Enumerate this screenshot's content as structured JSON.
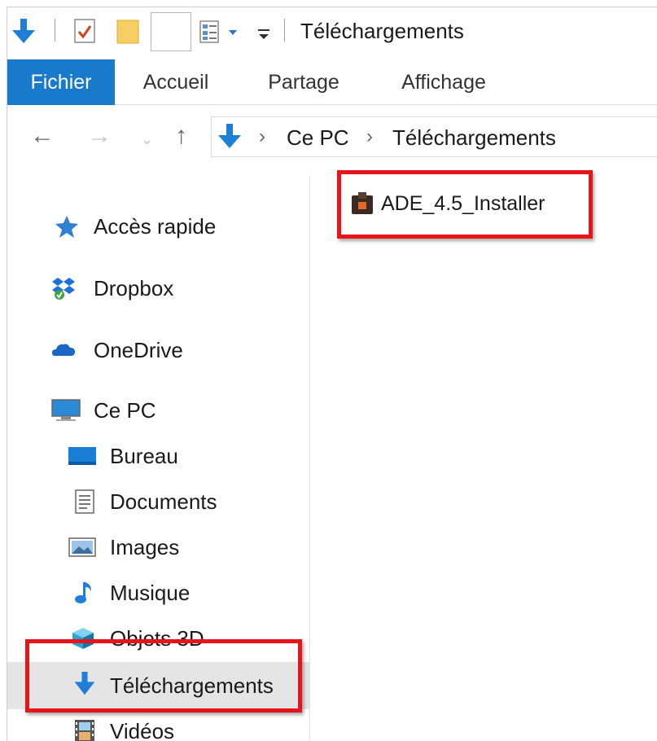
{
  "titlebar": {
    "title": "Téléchargements"
  },
  "ribbon": {
    "tabs": [
      "Fichier",
      "Accueil",
      "Partage",
      "Affichage"
    ]
  },
  "address": {
    "crumbs": [
      "Ce PC",
      "Téléchargements"
    ]
  },
  "nav": {
    "items": [
      {
        "label": "Accès rapide",
        "icon": "star-icon"
      },
      {
        "label": "Dropbox",
        "icon": "dropbox-icon"
      },
      {
        "label": "OneDrive",
        "icon": "cloud-icon"
      },
      {
        "label": "Ce PC",
        "icon": "computer-icon"
      },
      {
        "label": "Bureau",
        "icon": "desktop-folder-icon"
      },
      {
        "label": "Documents",
        "icon": "documents-icon"
      },
      {
        "label": "Images",
        "icon": "pictures-icon"
      },
      {
        "label": "Musique",
        "icon": "music-note-icon"
      },
      {
        "label": "Objets 3D",
        "icon": "cube-3d-icon"
      },
      {
        "label": "Téléchargements",
        "icon": "download-arrow-icon",
        "selected": true
      },
      {
        "label": "Vidéos",
        "icon": "film-icon"
      }
    ]
  },
  "files": [
    {
      "name": "ADE_4.5_Installer",
      "icon": "installer-icon"
    }
  ],
  "colors": {
    "file_tab": "#1979ca",
    "highlight": "#e5151a",
    "selection": "#e5e5e5"
  }
}
